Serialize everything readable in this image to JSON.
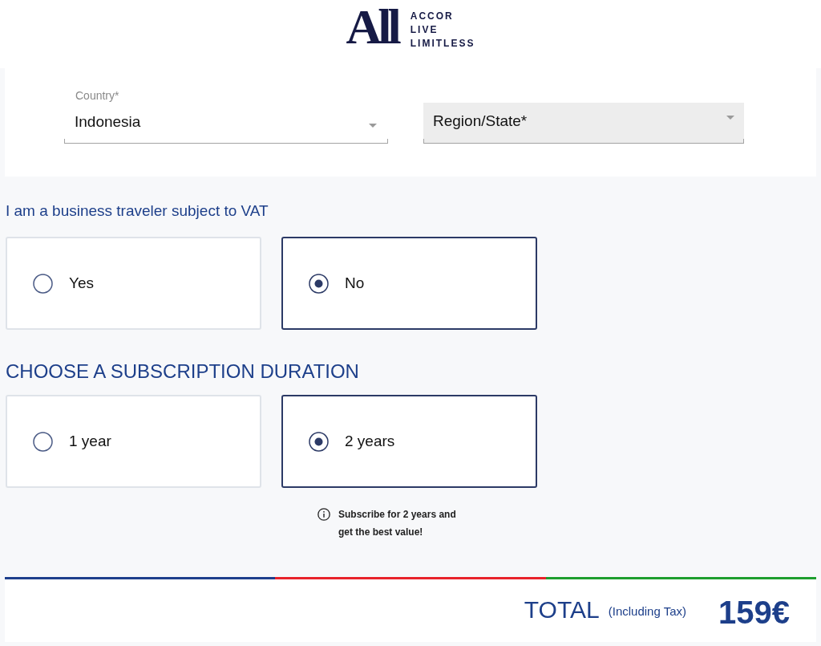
{
  "header": {
    "logo_mark": "All",
    "logo_lines": [
      "ACCOR",
      "LIVE",
      "LIMITLESS"
    ]
  },
  "address": {
    "country": {
      "label": "Country*",
      "value": "Indonesia"
    },
    "region": {
      "placeholder": "Region/State*"
    }
  },
  "vat": {
    "question": "I am a business traveler subject to VAT",
    "options": [
      {
        "label": "Yes",
        "selected": false
      },
      {
        "label": "No",
        "selected": true
      }
    ]
  },
  "duration": {
    "title": "CHOOSE A SUBSCRIPTION DURATION",
    "options": [
      {
        "label": "1 year",
        "selected": false
      },
      {
        "label": "2 years",
        "selected": true
      }
    ],
    "note": "Subscribe for 2 years and get the best value!"
  },
  "total": {
    "label": "TOTAL",
    "note": "(Including Tax)",
    "amount": "159€"
  }
}
